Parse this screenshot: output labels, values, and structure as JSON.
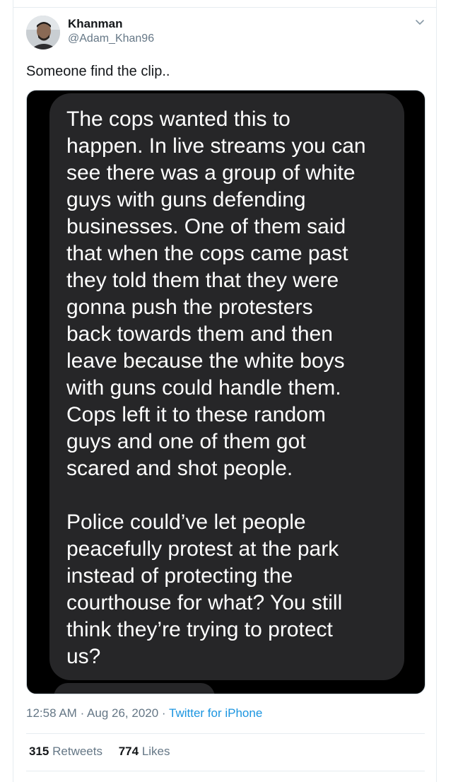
{
  "author": {
    "display_name": "Khanman",
    "handle": "@Adam_Khan96"
  },
  "tweet": {
    "text": "Someone find the clip..",
    "media_text": "The cops wanted this to\nhappen. In live streams you can\nsee there was a group of white\nguys with guns defending\nbusinesses. One of them said\nthat when the cops came past\nthey told them that they were\ngonna push the protesters\nback towards them and then\nleave because the white boys\nwith guns could handle them.\nCops left it to these random\nguys and one of them got\nscared and shot people.\n\nPolice could’ve let people\npeacefully protest at the park\ninstead of protecting the\ncourthouse for what? You still\nthink they’re trying to protect\nus?"
  },
  "meta": {
    "time": "12:58 AM",
    "separator": "·",
    "date": "Aug 26, 2020",
    "source": "Twitter for iPhone"
  },
  "stats": {
    "retweets_count": "315",
    "retweets_label": "Retweets",
    "likes_count": "774",
    "likes_label": "Likes"
  },
  "icons": {
    "menu": "chevron-down-icon"
  },
  "colors": {
    "link": "#1b95e0",
    "secondary_text": "#657786",
    "bubble": "#262628"
  }
}
